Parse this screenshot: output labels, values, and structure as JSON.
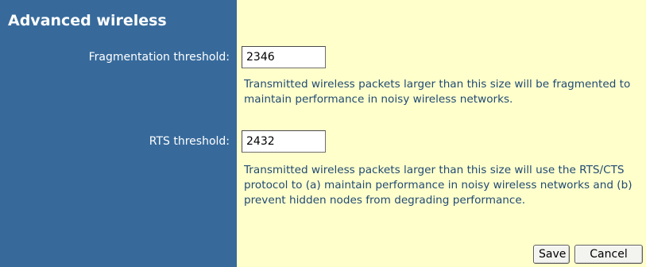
{
  "panel": {
    "title": "Advanced wireless",
    "colors": {
      "sidebar": "#376a9b",
      "content_background": "#ffffcc",
      "help_text": "#214a73"
    }
  },
  "fields": {
    "fragmentation": {
      "label": "Fragmentation threshold:",
      "value": "2346",
      "help": "Transmitted wireless packets larger than this size will be fragmented to maintain performance in noisy wireless networks."
    },
    "rts": {
      "label": "RTS threshold:",
      "value": "2432",
      "help": "Transmitted wireless packets larger than this size will use the RTS/CTS protocol to (a) maintain performance in noisy wireless networks and (b) prevent hidden nodes from degrading performance."
    }
  },
  "buttons": {
    "save": "Save",
    "cancel": "Cancel"
  }
}
